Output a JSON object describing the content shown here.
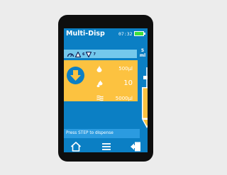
{
  "header": {
    "title": "Multi-Disp",
    "time": "07:32"
  },
  "mode_bar": {
    "icons": [
      "speed-gauge-icon",
      "aspirate-triangle-icon",
      "dispense-triangle-icon"
    ],
    "aspirate_speed": "6",
    "dispense_speed": "7"
  },
  "volume_unit": {
    "line1": "5",
    "line2": "ml"
  },
  "parameters": [
    {
      "icon": "droplet-icon",
      "value": "500µl"
    },
    {
      "icon": "multi-drop-icon",
      "value": "10"
    },
    {
      "icon": "waves-icon",
      "value": "5000µl"
    }
  ],
  "prompt": "Press STEP to dispense",
  "nav": [
    {
      "icon": "home-icon"
    },
    {
      "icon": "menu-icon"
    },
    {
      "icon": "exit-icon"
    }
  ],
  "colors": {
    "screen_bg": "#0b7fc4",
    "panel": "#fcc240",
    "mode_bar": "#74c8ec",
    "battery": "#3fe03c"
  }
}
